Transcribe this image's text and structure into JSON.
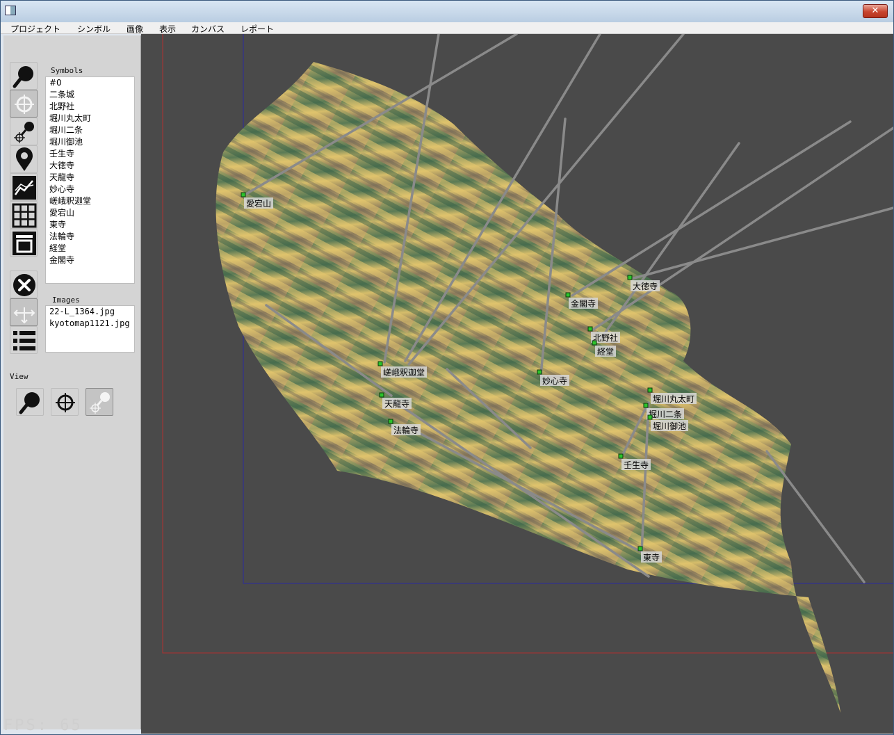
{
  "window": {
    "close_label": "✕"
  },
  "menu": [
    "プロジェクト",
    "シンボル",
    "画像",
    "表示",
    "カンバス",
    "レポート"
  ],
  "panel": {
    "symbols_title": "Symbols",
    "images_title": "Images",
    "view_title": "View",
    "symbols": [
      "#0",
      "二条城",
      "北野社",
      "堀川丸太町",
      "堀川二条",
      "堀川御池",
      "壬生寺",
      "大徳寺",
      "天龍寺",
      "妙心寺",
      "嵯峨釈迦堂",
      "愛宕山",
      "東寺",
      "法輪寺",
      "経堂",
      "金閣寺"
    ],
    "images": [
      "22-L_1364.jpg",
      "kyotomap1121.jpg"
    ]
  },
  "tools": [
    "magnifier-icon",
    "crosshair-icon",
    "add-point-icon",
    "map-pin-icon",
    "chart-icon",
    "grid-icon",
    "layout-icon",
    "delete-icon",
    "move-icon",
    "list-icon"
  ],
  "canvas": {
    "markers": [
      {
        "label": "愛宕山"
      },
      {
        "label": "大徳寺"
      },
      {
        "label": "金閣寺"
      },
      {
        "label": "北野社"
      },
      {
        "label": "経堂"
      },
      {
        "label": "嵯峨釈迦堂"
      },
      {
        "label": "妙心寺"
      },
      {
        "label": "天龍寺"
      },
      {
        "label": "法輪寺"
      },
      {
        "label": "堀川丸太町"
      },
      {
        "label": "堀川二条"
      },
      {
        "label": "堀川御池"
      },
      {
        "label": "壬生寺"
      },
      {
        "label": "東寺"
      }
    ],
    "fps": "FPS: 65"
  },
  "colors": {
    "canvas_bg": "#4a4a4a",
    "frame_red": "#b03030",
    "frame_blue": "#2a2aa0",
    "marker": "#2cc32c"
  }
}
